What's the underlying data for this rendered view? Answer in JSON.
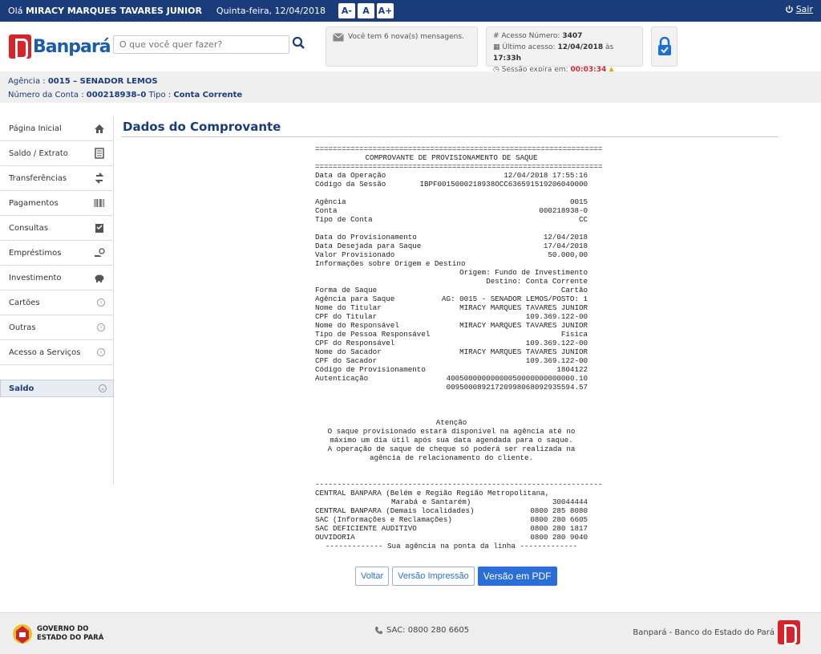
{
  "topbar": {
    "greeting_prefix": "Olá",
    "user_name": "MIRACY MARQUES TAVARES JUNIOR",
    "date": "Quinta-feira, 12/04/2018",
    "font_buttons": [
      "A-",
      "A",
      "A+"
    ],
    "logout_label": "Sair"
  },
  "header": {
    "brand": "Banpará",
    "search_placeholder": "O que você quer fazer?",
    "messages": "Você tem 6 nova(s) mensagens.",
    "access": {
      "number_label": "Acesso Número:",
      "number": "3407",
      "last_label": "Último acesso:",
      "last_date": "12/04/2018",
      "last_at": "às",
      "last_time": "17:33h",
      "expires_label": "Sessão expira em:",
      "expires": "00:03:34"
    }
  },
  "account": {
    "agency_label": "Agência :",
    "agency": "0015 – SENADOR LEMOS",
    "account_label": "Número da Conta :",
    "account": "000218938–0",
    "type_label": "Tipo :",
    "type": "Conta Corrente"
  },
  "sidebar": {
    "items": [
      {
        "label": "Página Inicial",
        "icon": "home-icon"
      },
      {
        "label": "Saldo / Extrato",
        "icon": "statement-icon"
      },
      {
        "label": "Transferências",
        "icon": "transfer-icon"
      },
      {
        "label": "Pagamentos",
        "icon": "barcode-icon"
      },
      {
        "label": "Consultas",
        "icon": "clipboard-icon"
      },
      {
        "label": "Empréstimos",
        "icon": "loan-icon"
      },
      {
        "label": "Investimento",
        "icon": "piggy-bank-icon"
      },
      {
        "label": "Cartões",
        "icon": "chevron-right-icon"
      },
      {
        "label": "Outras",
        "icon": "chevron-right-icon"
      },
      {
        "label": "Acesso a Serviços",
        "icon": "chevron-right-icon"
      }
    ],
    "saldo_label": "Saldo"
  },
  "main": {
    "title": "Dados do Comprovante"
  },
  "receipt": {
    "sep_eq": "=================================================================",
    "sep_dash": "-----------------------------------------------------------------",
    "heading": "COMPROVANTE DE PROVISIONAMENTO DE SAQUE",
    "rows1": [
      [
        "Data da Operação",
        "12/04/2018 17:55:16"
      ],
      [
        "Código da Sessão",
        "IBPF0015000218938OCC636591519206040000"
      ]
    ],
    "rows2": [
      [
        "Agência",
        "0015"
      ],
      [
        "Conta",
        "000218938-0"
      ],
      [
        "Tipo de Conta",
        "CC"
      ]
    ],
    "rows3": [
      [
        "Data do Provisionamento",
        "12/04/2018"
      ],
      [
        "Data Desejada para Saque",
        "17/04/2018"
      ],
      [
        "Valor Provisionado",
        "50.000,00"
      ]
    ],
    "info_label": "Informações sobre Origem e Destino",
    "origin": "Origem: Fundo de Investimento",
    "destination": "Destino: Conta Corrente",
    "rows4": [
      [
        "Forma de Saque",
        "Cartão"
      ],
      [
        "Agência para Saque",
        "AG: 0015 - SENADOR LEMOS/POSTO: 1"
      ],
      [
        "Nome do Titular",
        "MIRACY MARQUES TAVARES JUNIOR"
      ],
      [
        "CPF do Titular",
        "109.369.122-00"
      ],
      [
        "Nome do Responsável",
        "MIRACY MARQUES TAVARES JUNIOR"
      ],
      [
        "Tipo de Pessoa Responsável",
        "Física"
      ],
      [
        "CPF do Responsável",
        "109.369.122-00"
      ],
      [
        "Nome do Sacador",
        "MIRACY MARQUES TAVARES JUNIOR"
      ],
      [
        "CPF do Sacador",
        "109.369.122-00"
      ],
      [
        "Código de Provisionamento",
        "1804122"
      ],
      [
        "Autenticação",
        "40050000000000050000000000000.10"
      ]
    ],
    "auth_line2": "00950008921720998068092935594.57",
    "attention_title": "Atenção",
    "attention_lines": [
      "O saque provisionado estará disponível na agência até no",
      "máximo um dia útil após sua data agendada para o saque.",
      "A operação de saque de cheque só poderá ser realizada na",
      "agência de relacionamento do cliente."
    ],
    "central1_a": "CENTRAL BANPARA (Belém e Região Região Metropolitana,",
    "central1_b": "Marabá e Santarém)",
    "central1_phone": "30044444",
    "contacts": [
      [
        "CENTRAL BANPARA (Demais localidades)",
        "0800 285 8080"
      ],
      [
        "SAC (Informações e Reclamações)",
        "0800 280 6605"
      ],
      [
        "SAC DEFICIENTE AUDITIVO",
        "0800 280 1817"
      ],
      [
        "OUVIDORIA",
        "0800 280 9040"
      ]
    ],
    "closing": "------------- Sua agência na ponta da linha -------------"
  },
  "buttons": {
    "back": "Voltar",
    "print": "Versão Impressão",
    "pdf": "Versão em PDF"
  },
  "footer": {
    "gov_line1": "GOVERNO DO",
    "gov_line2": "ESTADO DO PARÁ",
    "sac": "SAC: 0800 280 6605",
    "bank": "Banpará - Banco do Estado do Pará"
  },
  "colors": {
    "navy": "#1b3c7a",
    "brand_red": "#d8232a",
    "brand_blue": "#1b5cab",
    "button_blue": "#2b6fd6"
  }
}
